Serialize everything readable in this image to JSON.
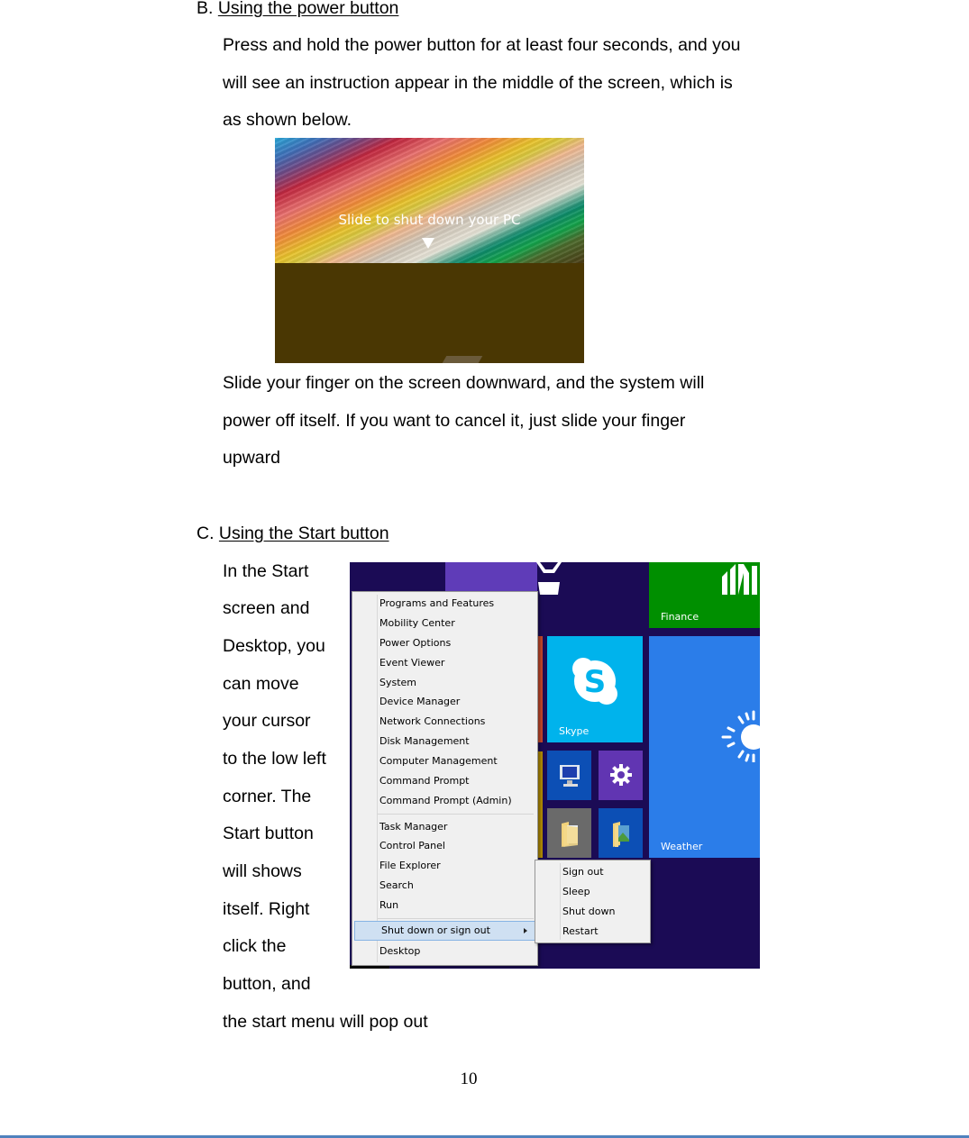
{
  "section_b": {
    "prefix": "B. ",
    "heading": "Using the power button",
    "para1_lines": [
      "Press and hold the power button for at least four seconds, and you",
      "will see an instruction appear in the middle of the screen, which is",
      "as shown below."
    ],
    "figure": {
      "message": "Slide to shut down your PC",
      "arrow_icon": "down-triangle"
    },
    "para2_lines": [
      "Slide your finger on the screen downward, and the system will",
      "power off itself. If you want to cancel it, just slide your finger",
      "upward"
    ]
  },
  "section_c": {
    "prefix": "C. ",
    "heading": "Using the Start button",
    "side_lines": [
      "In the Start",
      "screen and",
      "Desktop, you",
      "can move",
      "your cursor",
      "to the low left",
      "corner. The",
      "Start button",
      "will shows",
      "itself. Right",
      "click the",
      "button, and",
      "the start menu will pop out"
    ],
    "figure": {
      "tiles": {
        "finance": "Finance",
        "skype": "Skype",
        "weather": "Weather"
      },
      "context_menu": {
        "group1": [
          "Programs and Features",
          "Mobility Center",
          "Power Options",
          "Event Viewer",
          "System",
          "Device Manager",
          "Network Connections",
          "Disk Management",
          "Computer Management",
          "Command Prompt",
          "Command Prompt (Admin)"
        ],
        "group2": [
          "Task Manager",
          "Control Panel",
          "File Explorer",
          "Search",
          "Run"
        ],
        "highlighted": "Shut down or sign out",
        "last": "Desktop"
      },
      "submenu": [
        "Sign out",
        "Sleep",
        "Shut down",
        "Restart"
      ]
    }
  },
  "footer": {
    "page_number": "10"
  },
  "colors": {
    "start_bg": "#1b0b55",
    "finance_tile": "#008f00",
    "skype_tile": "#00b3ec",
    "weather_tile": "#2b7de9",
    "footer_rule": "#4f81bd"
  }
}
